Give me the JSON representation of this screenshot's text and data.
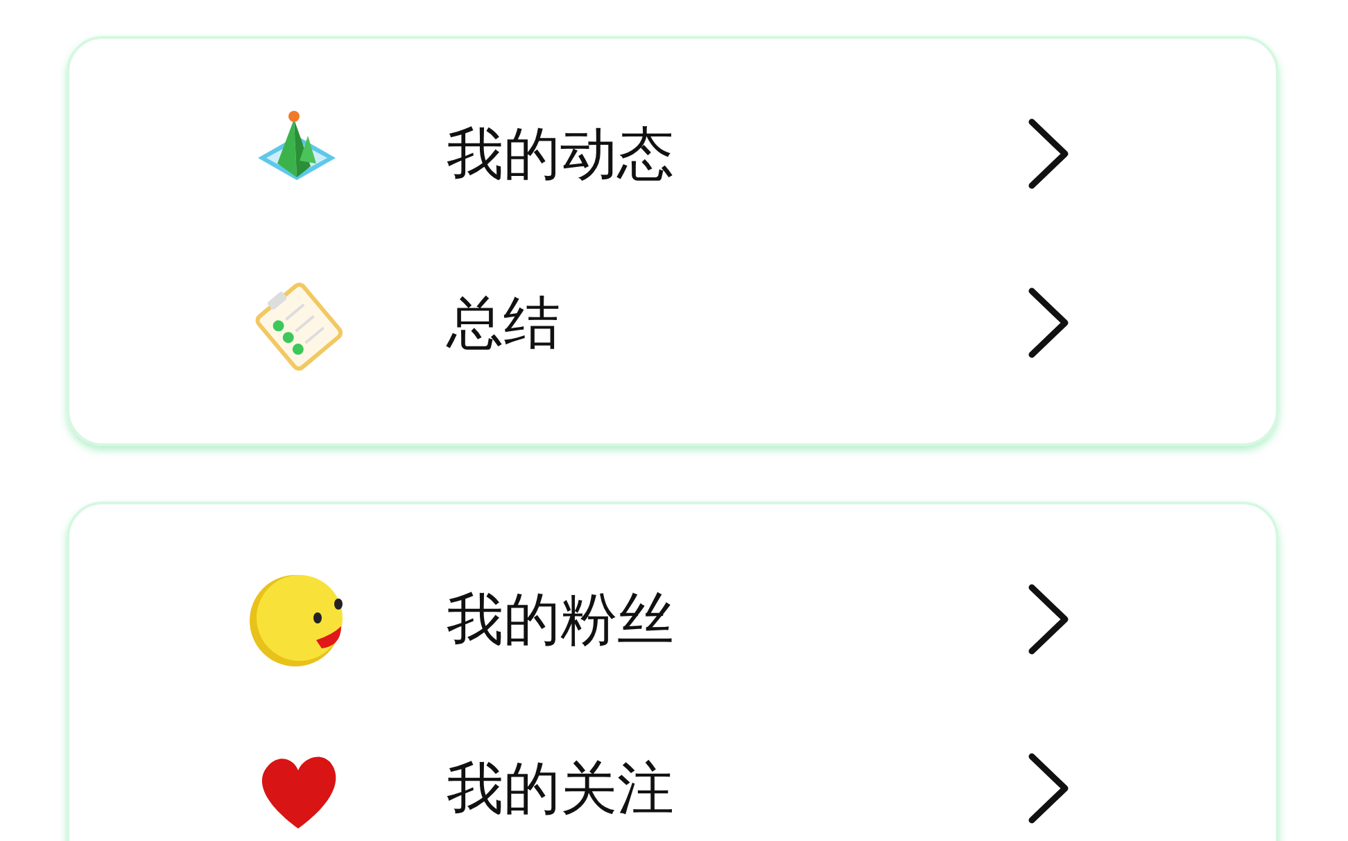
{
  "groups": [
    {
      "items": [
        {
          "kind": "mountain",
          "label": "我的动态"
        },
        {
          "kind": "clipboard",
          "label": "总结"
        }
      ]
    },
    {
      "items": [
        {
          "kind": "smiley",
          "label": "我的粉丝"
        },
        {
          "kind": "heart",
          "label": "我的关注"
        }
      ]
    }
  ]
}
